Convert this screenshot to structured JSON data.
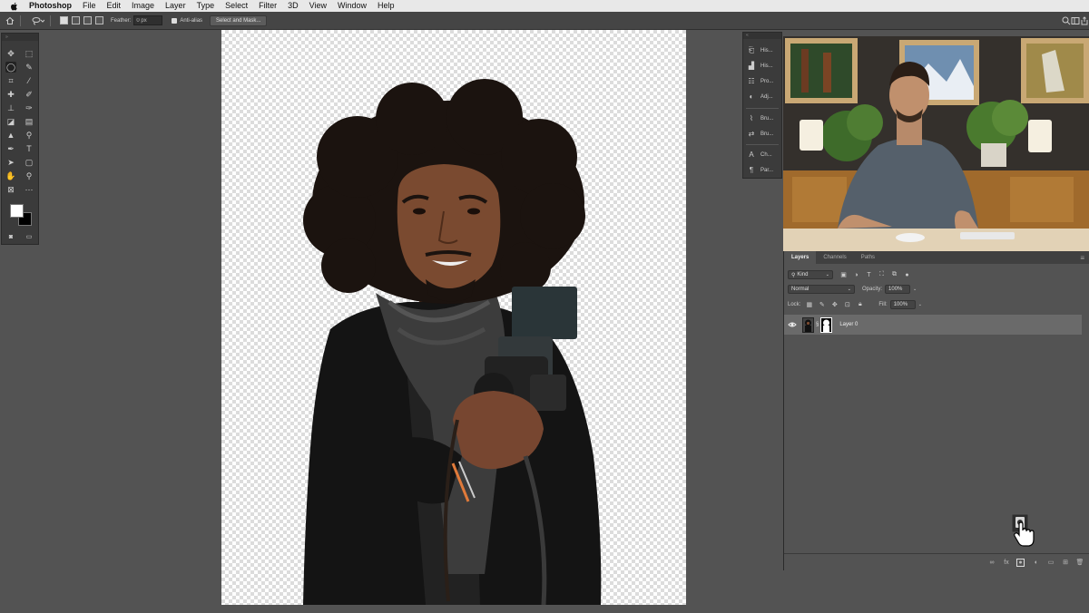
{
  "menubar": {
    "app": "Photoshop",
    "items": [
      "File",
      "Edit",
      "Image",
      "Layer",
      "Type",
      "Select",
      "Filter",
      "3D",
      "View",
      "Window",
      "Help"
    ]
  },
  "options": {
    "feather_label": "Feather:",
    "feather_value": "0 px",
    "antialias_label": "Anti-alias",
    "select_mask_label": "Select and Mask..."
  },
  "dock": {
    "items": [
      "His...",
      "His...",
      "Pro...",
      "Adj...",
      "Bru...",
      "Bru...",
      "Ch...",
      "Par..."
    ]
  },
  "layers": {
    "tabs": [
      "Layers",
      "Channels",
      "Paths"
    ],
    "kind_label": "Kind",
    "blend_mode": "Normal",
    "opacity_label": "Opacity:",
    "opacity_value": "100%",
    "lock_label": "Lock:",
    "fill_label": "Fill:",
    "fill_value": "100%",
    "layer_name": "Layer 0"
  },
  "colors": {
    "ui_bg": "#535353",
    "panel_bg": "#3b3b3b",
    "selected_layer": "#6a6a6a"
  },
  "icons": {
    "cursor": "pointing-hand-icon"
  }
}
